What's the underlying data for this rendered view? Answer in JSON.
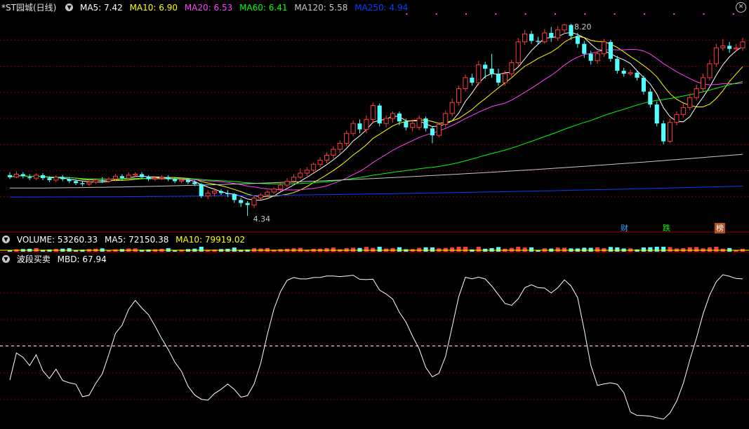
{
  "header": {
    "stock": "*ST园城(日线)",
    "indicators": [
      {
        "label": "MA5: 7.42",
        "color": "#ffffff"
      },
      {
        "label": "MA10: 6.90",
        "color": "#ffff00"
      },
      {
        "label": "MA20: 6.53",
        "color": "#ff40ff"
      },
      {
        "label": "MA60: 6.41",
        "color": "#00ff00"
      },
      {
        "label": "MA120: 5.58",
        "color": "#c8c8c8"
      },
      {
        "label": "MA250: 4.94",
        "color": "#0040ff"
      }
    ]
  },
  "volume_header": {
    "label": "VOLUME: 53260.33",
    "ma5": "MA5: 72150.38",
    "ma10": "MA10: 79919.02"
  },
  "indicator_header": {
    "name": "波段买卖",
    "mbd": "MBD: 67.94"
  },
  "annotations": {
    "high": "8.20",
    "low": "4.34"
  },
  "events": [
    {
      "label": "财",
      "color": "#40a0ff"
    },
    {
      "label": "跌",
      "color": "#00ff00"
    },
    {
      "label": "榜",
      "color": "#ffffff",
      "bg": "#b05020"
    }
  ],
  "colors": {
    "up": "#ff3c3c",
    "down": "#54ffff",
    "grid": "#800000",
    "dash": "#ffffff"
  },
  "chart_data": {
    "type": "candlestick",
    "price_range": [
      4.2,
      8.4
    ],
    "candles": [
      [
        5.16,
        5.12,
        5.22,
        5.08
      ],
      [
        5.12,
        5.18,
        5.24,
        5.1
      ],
      [
        5.18,
        5.14,
        5.22,
        5.1
      ],
      [
        5.12,
        5.1,
        5.18,
        5.06
      ],
      [
        5.1,
        5.16,
        5.2,
        5.06
      ],
      [
        5.16,
        5.1,
        5.2,
        5.06
      ],
      [
        5.1,
        5.06,
        5.14,
        5.02
      ],
      [
        5.06,
        5.12,
        5.16,
        5.02
      ],
      [
        5.12,
        5.08,
        5.16,
        5.04
      ],
      [
        5.08,
        5.04,
        5.12,
        5.0
      ],
      [
        5.04,
        5.0,
        5.08,
        4.96
      ],
      [
        5.0,
        4.98,
        5.04,
        4.94
      ],
      [
        4.98,
        5.02,
        5.08,
        4.94
      ],
      [
        5.02,
        5.06,
        5.1,
        4.98
      ],
      [
        5.06,
        5.04,
        5.12,
        5.0
      ],
      [
        5.04,
        5.08,
        5.12,
        5.0
      ],
      [
        5.08,
        5.14,
        5.18,
        5.04
      ],
      [
        5.14,
        5.1,
        5.18,
        5.06
      ],
      [
        5.1,
        5.16,
        5.22,
        5.08
      ],
      [
        5.16,
        5.18,
        5.22,
        5.12
      ],
      [
        5.18,
        5.12,
        5.22,
        5.08
      ],
      [
        5.12,
        5.08,
        5.16,
        5.04
      ],
      [
        5.08,
        5.1,
        5.14,
        5.04
      ],
      [
        5.1,
        5.12,
        5.16,
        5.06
      ],
      [
        5.12,
        5.08,
        5.16,
        5.04
      ],
      [
        5.08,
        5.04,
        5.12,
        5.0
      ],
      [
        5.04,
        5.06,
        5.1,
        5.0
      ],
      [
        5.06,
        5.02,
        5.1,
        4.98
      ],
      [
        5.02,
        4.98,
        5.06,
        4.94
      ],
      [
        4.98,
        4.74,
        5.0,
        4.7
      ],
      [
        4.74,
        4.8,
        4.86,
        4.68
      ],
      [
        4.8,
        4.84,
        4.9,
        4.74
      ],
      [
        4.84,
        4.8,
        4.88,
        4.76
      ],
      [
        4.8,
        4.78,
        4.86,
        4.72
      ],
      [
        4.78,
        4.66,
        4.8,
        4.6
      ],
      [
        4.66,
        4.6,
        4.7,
        4.52
      ],
      [
        4.6,
        4.56,
        4.64,
        4.34
      ],
      [
        4.56,
        4.7,
        4.74,
        4.5
      ],
      [
        4.7,
        4.76,
        4.8,
        4.66
      ],
      [
        4.76,
        4.82,
        4.86,
        4.72
      ],
      [
        4.82,
        4.88,
        4.92,
        4.78
      ],
      [
        4.88,
        4.96,
        5.0,
        4.84
      ],
      [
        4.96,
        5.04,
        5.1,
        4.92
      ],
      [
        5.04,
        5.12,
        5.18,
        5.0
      ],
      [
        5.12,
        5.2,
        5.3,
        5.08
      ],
      [
        5.2,
        5.26,
        5.32,
        5.14
      ],
      [
        5.26,
        5.38,
        5.42,
        5.22
      ],
      [
        5.38,
        5.46,
        5.52,
        5.32
      ],
      [
        5.46,
        5.56,
        5.62,
        5.4
      ],
      [
        5.56,
        5.68,
        5.74,
        5.5
      ],
      [
        5.68,
        5.8,
        5.86,
        5.6
      ],
      [
        5.8,
        6.0,
        6.06,
        5.74
      ],
      [
        6.0,
        6.2,
        6.26,
        5.94
      ],
      [
        6.2,
        6.08,
        6.28,
        6.0
      ],
      [
        6.08,
        6.28,
        6.36,
        6.0
      ],
      [
        6.28,
        6.56,
        6.62,
        6.2
      ],
      [
        6.56,
        6.2,
        6.6,
        6.14
      ],
      [
        6.2,
        6.3,
        6.36,
        6.12
      ],
      [
        6.3,
        6.4,
        6.44,
        6.22
      ],
      [
        6.4,
        6.24,
        6.44,
        6.16
      ],
      [
        6.24,
        6.12,
        6.3,
        6.06
      ],
      [
        6.12,
        6.2,
        6.28,
        6.04
      ],
      [
        6.12,
        6.3,
        6.36,
        6.06
      ],
      [
        6.3,
        6.1,
        6.34,
        6.04
      ],
      [
        6.1,
        5.96,
        6.14,
        5.8
      ],
      [
        5.96,
        6.18,
        6.22,
        5.92
      ],
      [
        6.18,
        6.4,
        6.46,
        6.12
      ],
      [
        6.4,
        6.62,
        6.7,
        6.34
      ],
      [
        6.62,
        6.9,
        6.96,
        6.56
      ],
      [
        6.9,
        7.12,
        7.18,
        6.84
      ],
      [
        7.12,
        7.02,
        7.2,
        6.96
      ],
      [
        7.02,
        7.38,
        7.46,
        6.96
      ],
      [
        7.38,
        7.3,
        7.44,
        7.1
      ],
      [
        7.3,
        7.2,
        7.6,
        7.12
      ],
      [
        7.2,
        7.02,
        7.3,
        6.96
      ],
      [
        7.02,
        7.2,
        7.26,
        6.96
      ],
      [
        7.2,
        7.42,
        7.48,
        7.14
      ],
      [
        7.42,
        7.84,
        7.92,
        7.36
      ],
      [
        7.84,
        8.0,
        8.08,
        7.78
      ],
      [
        8.0,
        7.86,
        8.06,
        7.8
      ],
      [
        7.86,
        7.84,
        7.94,
        7.78
      ],
      [
        7.84,
        8.02,
        8.1,
        7.8
      ],
      [
        8.02,
        7.92,
        8.14,
        7.84
      ],
      [
        7.92,
        8.08,
        8.16,
        7.86
      ],
      [
        8.08,
        8.18,
        8.2,
        8.0
      ],
      [
        8.18,
        7.96,
        8.2,
        7.88
      ],
      [
        7.96,
        7.8,
        8.02,
        7.72
      ],
      [
        7.8,
        7.6,
        7.86,
        7.52
      ],
      [
        7.6,
        7.46,
        7.66,
        7.38
      ],
      [
        7.46,
        7.6,
        7.66,
        7.4
      ],
      [
        7.6,
        7.84,
        7.9,
        7.54
      ],
      [
        7.84,
        7.5,
        7.88,
        7.44
      ],
      [
        7.5,
        7.26,
        7.56,
        7.2
      ],
      [
        7.26,
        7.2,
        7.32,
        7.14
      ],
      [
        7.2,
        7.22,
        7.28,
        7.16
      ],
      [
        7.22,
        7.12,
        7.26,
        7.06
      ],
      [
        7.12,
        6.84,
        7.16,
        6.78
      ],
      [
        6.84,
        6.58,
        6.9,
        6.52
      ],
      [
        6.58,
        6.2,
        6.64,
        6.14
      ],
      [
        6.2,
        5.84,
        6.26,
        5.78
      ],
      [
        5.84,
        6.22,
        6.3,
        5.8
      ],
      [
        6.22,
        6.38,
        6.44,
        6.16
      ],
      [
        6.38,
        6.52,
        6.6,
        6.32
      ],
      [
        6.52,
        6.72,
        6.8,
        6.46
      ],
      [
        6.72,
        6.9,
        6.98,
        6.66
      ],
      [
        6.9,
        7.12,
        7.2,
        6.84
      ],
      [
        7.12,
        7.4,
        7.48,
        7.06
      ],
      [
        7.4,
        7.72,
        7.8,
        7.34
      ],
      [
        7.72,
        7.76,
        7.9,
        7.66
      ],
      [
        7.76,
        7.7,
        7.84,
        7.62
      ],
      [
        7.7,
        7.72,
        7.8,
        7.64
      ],
      [
        7.72,
        7.84,
        7.92,
        7.66
      ]
    ],
    "mbd_range": [
      0,
      100
    ],
    "mbd_reference": 50
  }
}
